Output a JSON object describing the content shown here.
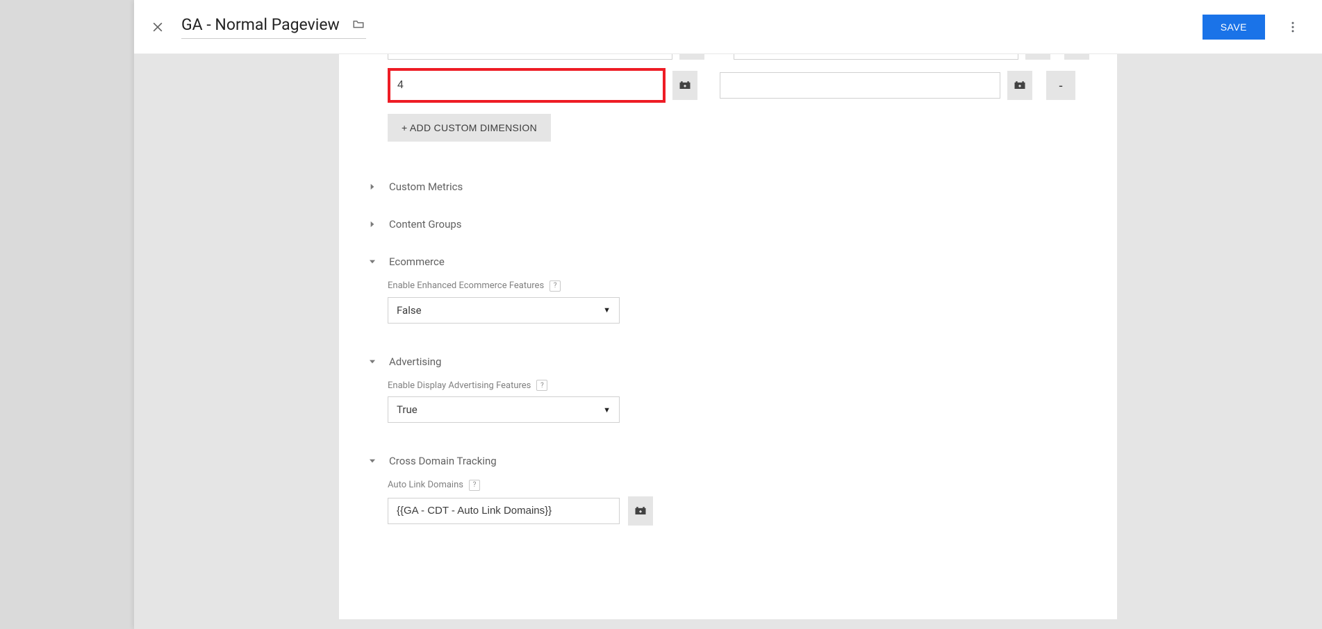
{
  "header": {
    "title": "GA - Normal Pageview",
    "save_label": "SAVE"
  },
  "custom_dimensions": {
    "index_value": "4",
    "value_value": "",
    "add_label": "+ ADD CUSTOM DIMENSION",
    "remove_label": "-"
  },
  "sections": {
    "custom_metrics": {
      "label": "Custom Metrics"
    },
    "content_groups": {
      "label": "Content Groups"
    },
    "ecommerce": {
      "label": "Ecommerce",
      "field_label": "Enable Enhanced Ecommerce Features",
      "value": "False"
    },
    "advertising": {
      "label": "Advertising",
      "field_label": "Enable Display Advertising Features",
      "value": "True"
    },
    "cross_domain": {
      "label": "Cross Domain Tracking",
      "field_label": "Auto Link Domains",
      "value": "{{GA - CDT - Auto Link Domains}}"
    }
  },
  "help_glyph": "?"
}
